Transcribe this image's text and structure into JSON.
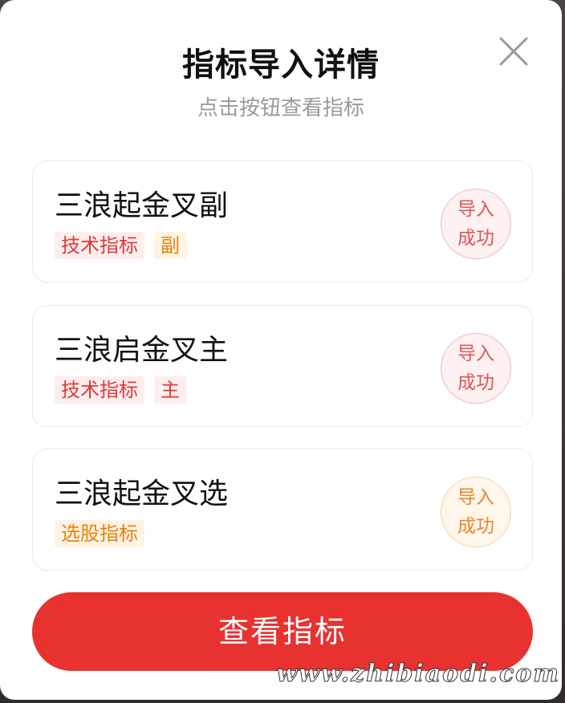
{
  "dialog": {
    "title": "指标导入详情",
    "subtitle": "点击按钮查看指标",
    "close_icon": "close-icon"
  },
  "indicators": [
    {
      "name": "三浪起金叉副",
      "tags": [
        {
          "label": "技术指标",
          "color": "#e03a3a"
        },
        {
          "label": "副",
          "color": "#e8820e"
        }
      ],
      "status_line1": "导入",
      "status_line2": "成功",
      "status_color": "#e05555"
    },
    {
      "name": "三浪启金叉主",
      "tags": [
        {
          "label": "技术指标",
          "color": "#e03a3a"
        },
        {
          "label": "主",
          "color": "#e03a3a"
        }
      ],
      "status_line1": "导入",
      "status_line2": "成功",
      "status_color": "#e05555"
    },
    {
      "name": "三浪起金叉选",
      "tags": [
        {
          "label": "选股指标",
          "color": "#e8820e"
        }
      ],
      "status_line1": "导入",
      "status_line2": "成功",
      "status_color": "#e8862a"
    }
  ],
  "footer": {
    "view_button_label": "查看指标"
  },
  "watermark": "www.zhibiaodi.com",
  "colors": {
    "accent": "#e8322f",
    "tag_red": "#e03a3a",
    "tag_orange": "#e8820e"
  }
}
